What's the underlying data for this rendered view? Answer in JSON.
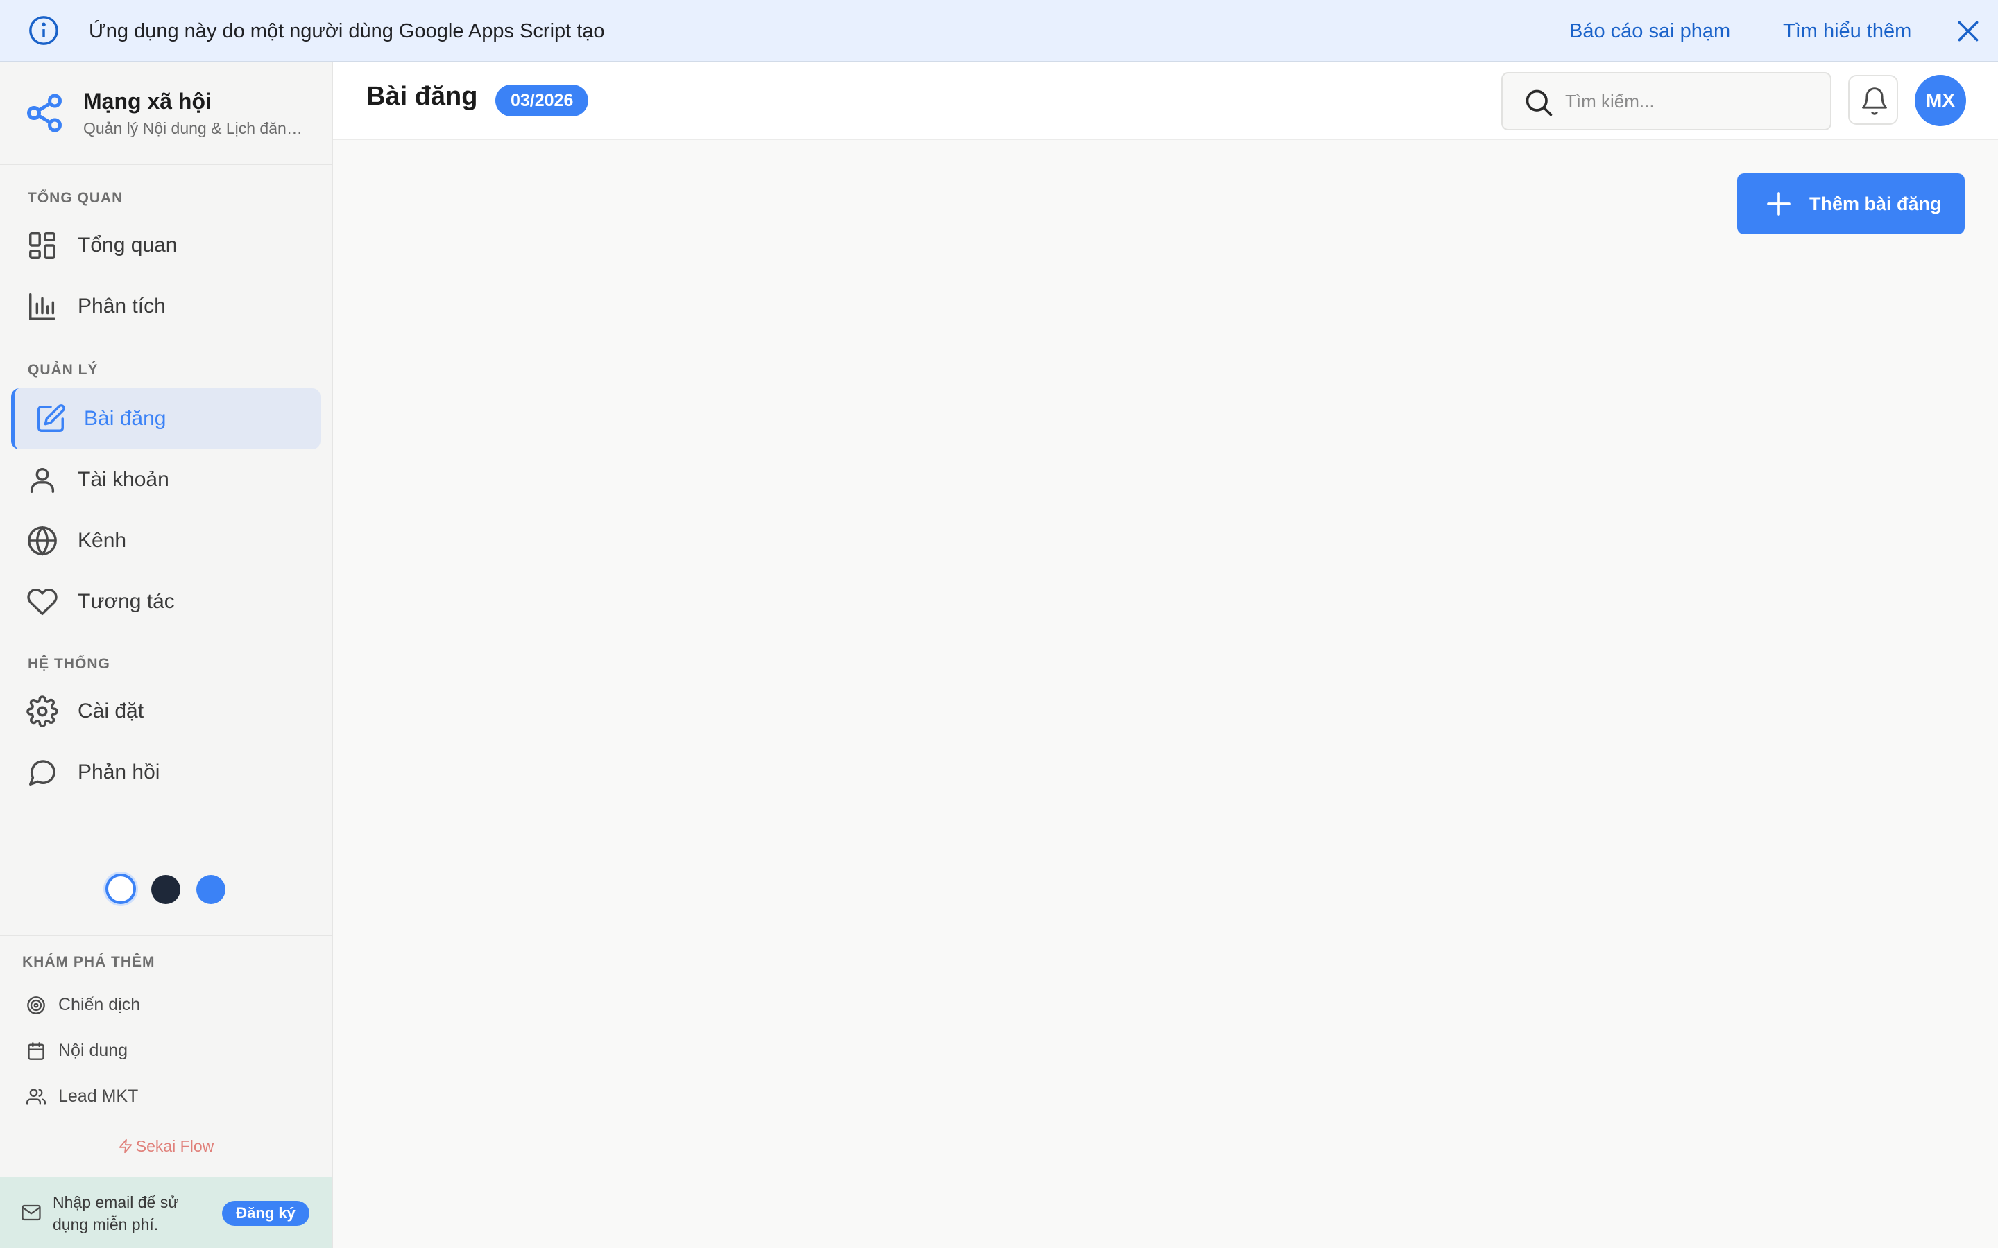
{
  "banner": {
    "icon": "info-icon",
    "message": "Ứng dụng này do một người dùng Google Apps Script tạo",
    "report_link": "Báo cáo sai phạm",
    "learn_link": "Tìm hiểu thêm",
    "close_icon": "close-icon"
  },
  "brand": {
    "icon": "share-icon",
    "name": "Mạng xã hội",
    "subtitle": "Quản lý Nội dung & Lịch đăng bài"
  },
  "sidebar": {
    "sections": [
      {
        "label": "TỔNG QUAN"
      },
      {
        "label": "QUẢN LÝ"
      },
      {
        "label": "HỆ THỐNG"
      }
    ],
    "items": [
      {
        "label": "Tổng quan",
        "icon": "grid-icon"
      },
      {
        "label": "Phân tích",
        "icon": "bar-chart-icon"
      },
      {
        "label": "Bài đăng",
        "icon": "edit-icon",
        "active": true
      },
      {
        "label": "Tài khoản",
        "icon": "user-icon"
      },
      {
        "label": "Kênh",
        "icon": "globe-icon"
      },
      {
        "label": "Tương tác",
        "icon": "heart-icon"
      },
      {
        "label": "Cài đặt",
        "icon": "gear-icon"
      },
      {
        "label": "Phản hồi",
        "icon": "chat-icon"
      }
    ],
    "themes": [
      "light",
      "dark",
      "blue"
    ]
  },
  "explore": {
    "label": "KHÁM PHÁ THÊM",
    "items": [
      {
        "label": "Chiến dịch",
        "icon": "target-icon"
      },
      {
        "label": "Nội dung",
        "icon": "calendar-icon"
      },
      {
        "label": "Lead MKT",
        "icon": "users-icon"
      }
    ],
    "powered_by": "Sekai Flow"
  },
  "signup": {
    "text": "Nhập email để sử dụng miễn phí.",
    "button": "Đăng ký"
  },
  "header": {
    "title": "Bài đăng",
    "badge": "03/2026",
    "search_placeholder": "Tìm kiếm...",
    "avatar_initials": "MX"
  },
  "main": {
    "add_button": "Thêm bài đăng"
  },
  "colors": {
    "accent": "#3b82f6",
    "banner_bg": "#e8f0fe",
    "sidebar_bg": "#f5f5f4",
    "active_bg": "#e2e8f4",
    "signup_bg": "#dbece6",
    "powered_text": "#e0807a"
  }
}
